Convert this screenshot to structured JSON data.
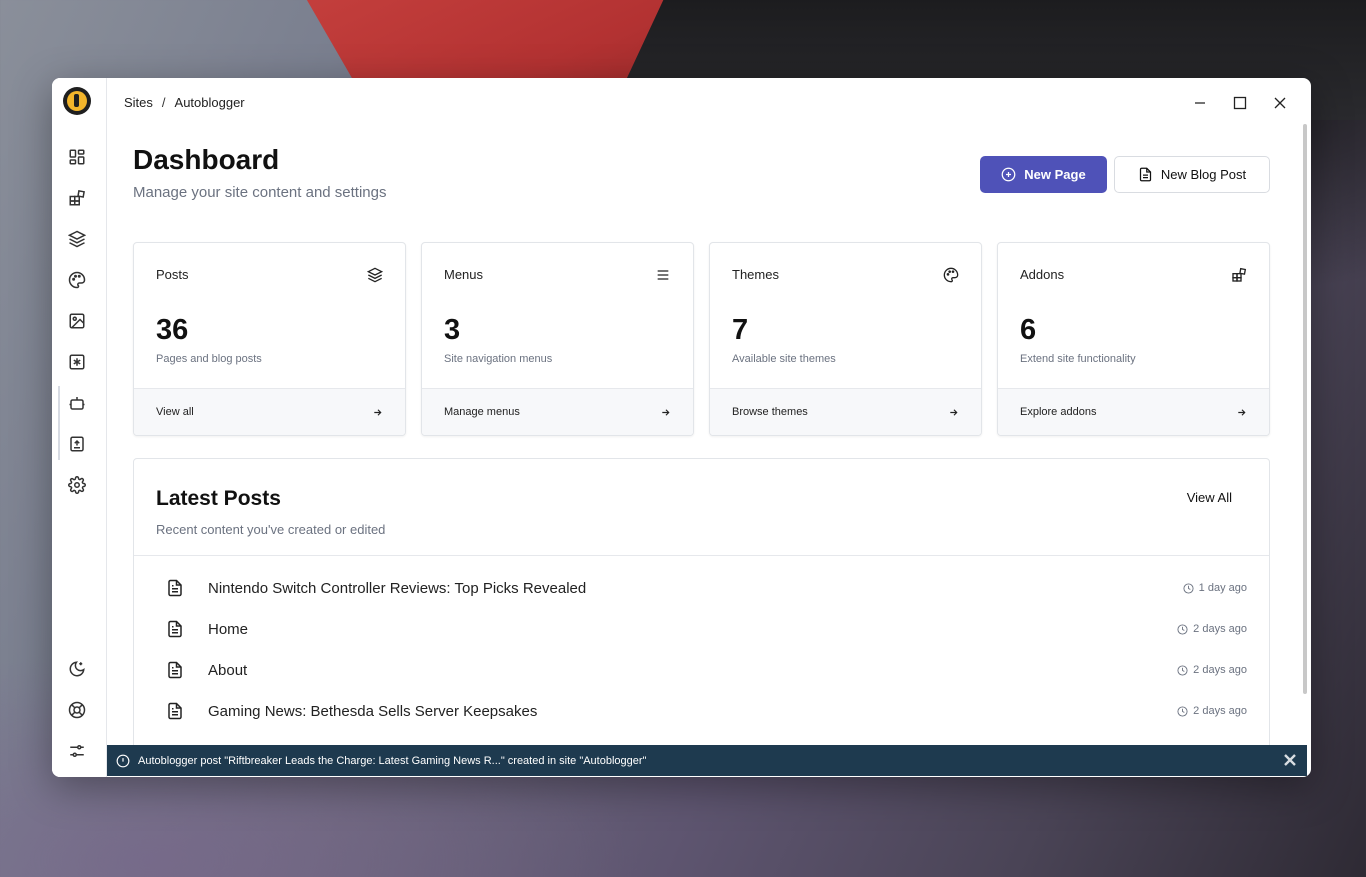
{
  "breadcrumb": {
    "root": "Sites",
    "separator": "/",
    "current": "Autoblogger"
  },
  "header": {
    "title": "Dashboard",
    "subtitle": "Manage your site content and settings",
    "primary_button": "New Page",
    "secondary_button": "New Blog Post"
  },
  "sidebar": {
    "icons": [
      "dashboard-icon",
      "addons-icon",
      "layers-icon",
      "palette-icon",
      "image-icon",
      "asterisk-icon",
      "robot-icon",
      "upload-icon",
      "settings-icon"
    ],
    "bottom_icons": [
      "dark-mode-icon",
      "help-icon",
      "sliders-icon"
    ]
  },
  "cards": [
    {
      "title": "Posts",
      "icon": "layers-icon",
      "value": "36",
      "desc": "Pages and blog posts",
      "link": "View all"
    },
    {
      "title": "Menus",
      "icon": "menu-icon",
      "value": "3",
      "desc": "Site navigation menus",
      "link": "Manage menus"
    },
    {
      "title": "Themes",
      "icon": "palette-icon",
      "value": "7",
      "desc": "Available site themes",
      "link": "Browse themes"
    },
    {
      "title": "Addons",
      "icon": "addons-icon",
      "value": "6",
      "desc": "Extend site functionality",
      "link": "Explore addons"
    }
  ],
  "latest": {
    "title": "Latest Posts",
    "subtitle": "Recent content you've created or edited",
    "view_all": "View All",
    "posts": [
      {
        "title": "Nintendo Switch Controller Reviews: Top Picks Revealed",
        "time": "1 day ago"
      },
      {
        "title": "Home",
        "time": "2 days ago"
      },
      {
        "title": "About",
        "time": "2 days ago"
      },
      {
        "title": "Gaming News: Bethesda Sells Server Keepsakes",
        "time": "2 days ago"
      }
    ]
  },
  "toast": {
    "message": "Autoblogger post \"Riftbreaker Leads the Charge: Latest Gaming News R...\" created in site \"Autoblogger\""
  },
  "colors": {
    "accent": "#4f52b8",
    "toast_bg": "#1e3a4f",
    "logo": "#f3b52b"
  }
}
